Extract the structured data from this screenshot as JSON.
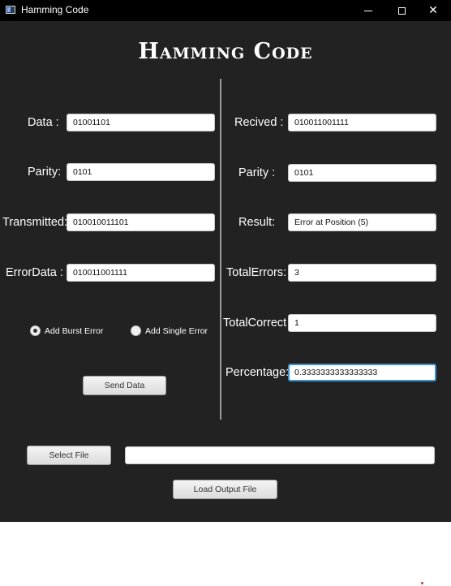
{
  "window": {
    "title": "Hamming Code"
  },
  "heading": "Hamming Code",
  "sender": {
    "data_label": "Data :",
    "data_value": "01001101",
    "parity_label": "Parity:",
    "parity_value": "0101",
    "transmitted_label": "Transmitted:",
    "transmitted_value": "010010011101",
    "errordata_label": "ErrorData :",
    "errordata_value": "010011001111",
    "burst_error_label": "Add Burst Error",
    "single_error_label": "Add Single Error",
    "selected_error_mode": "Add Burst Error",
    "send_button": "Send Data"
  },
  "receiver": {
    "received_label": "Recived :",
    "received_value": "010011001111",
    "parity_label": "Parity :",
    "parity_value": "0101",
    "result_label": "Result:",
    "result_value": "Error at Position (5)",
    "total_errors_label": "TotalErrors:",
    "total_errors_value": "3",
    "total_correct_label": "TotalCorrect",
    "total_correct_value": "1",
    "percentage_label": "Percentage:",
    "percentage_value": "0.3333333333333333"
  },
  "file": {
    "select_button": "Select File",
    "path_value": "",
    "load_button": "Load Output File"
  },
  "colors": {
    "background": "#222222",
    "titlebar": "#000000",
    "focus_border": "#3c93d0"
  }
}
